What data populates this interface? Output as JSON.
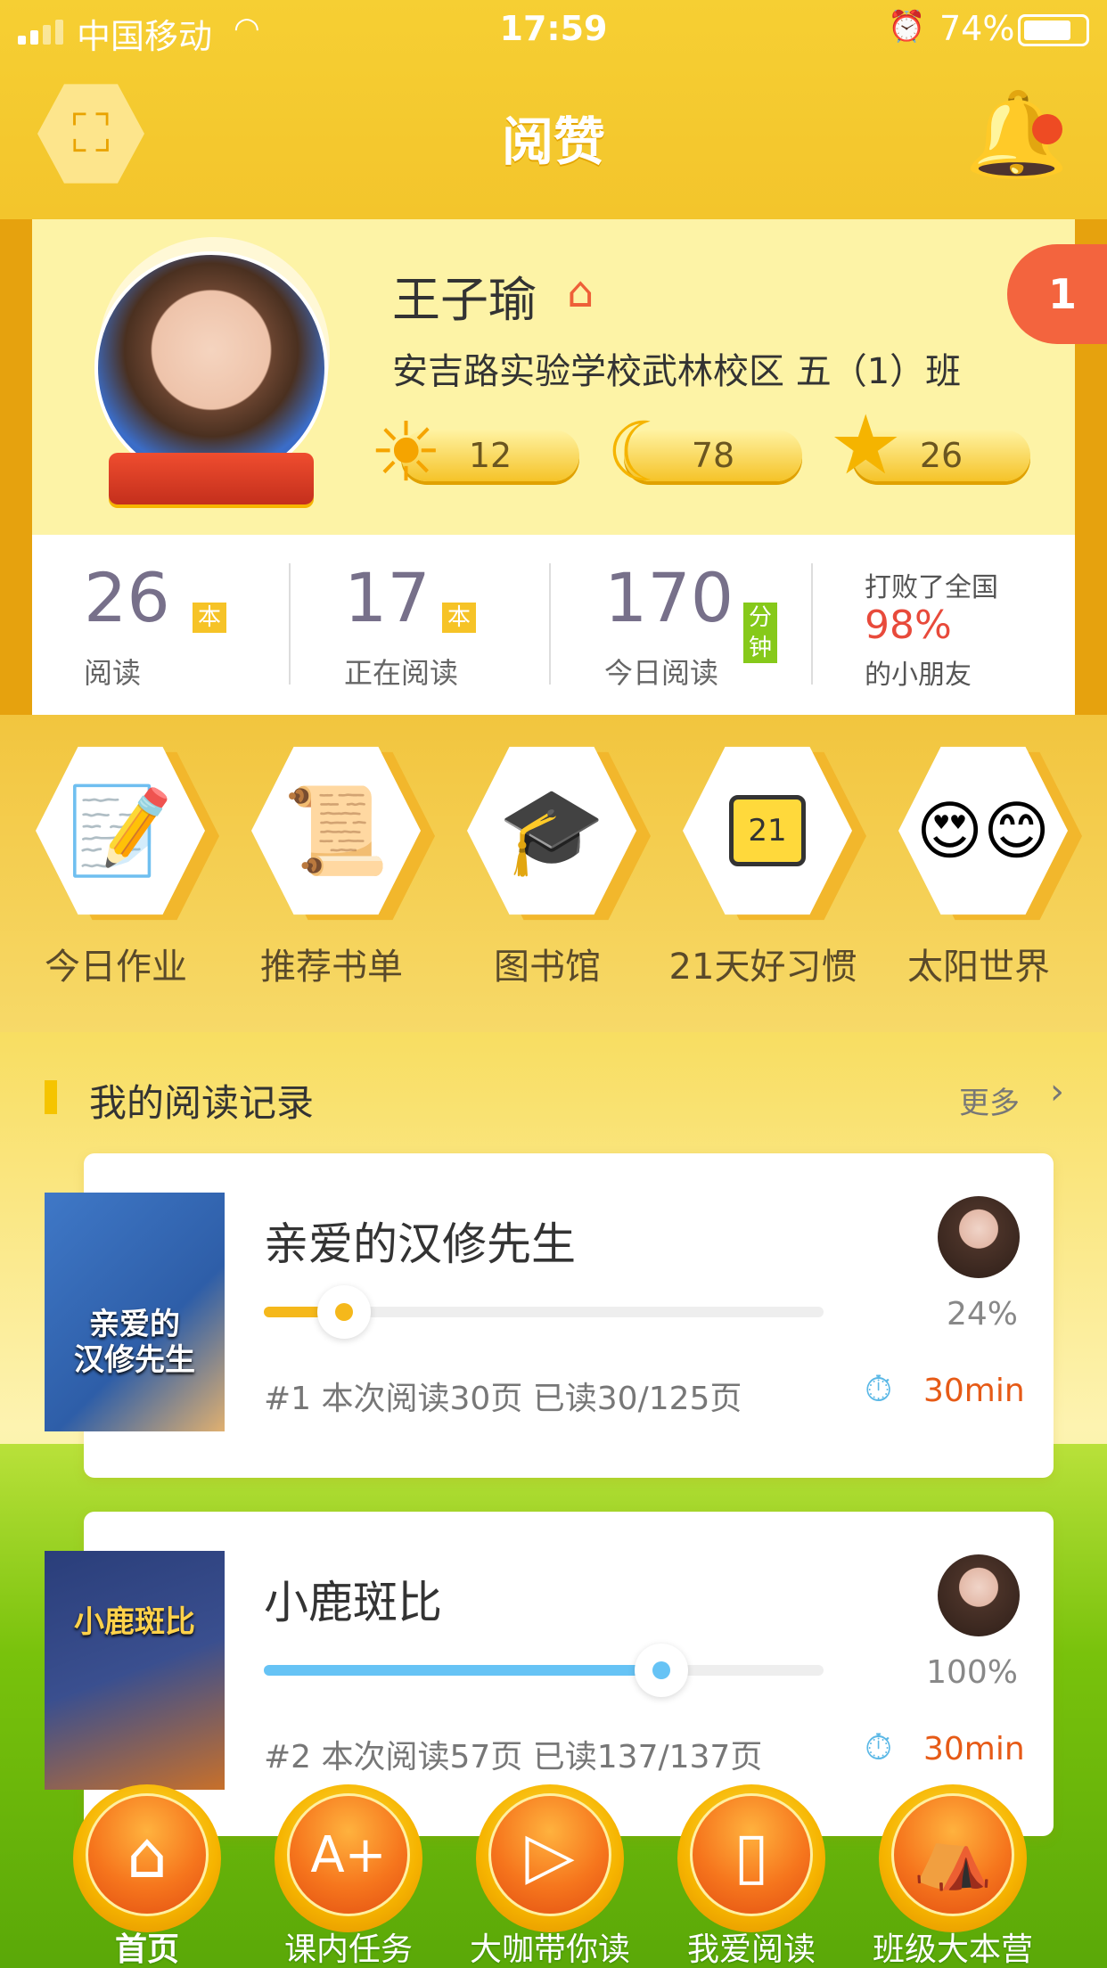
{
  "status_bar": {
    "carrier": "中国移动",
    "time": "17:59",
    "battery": "74%"
  },
  "header": {
    "title": "阅赞"
  },
  "profile": {
    "name": "王子瑜",
    "school": "安吉路实验学校武林校区   五（1）班",
    "notification_badge": "1",
    "sun_count": "12",
    "moon_count": "78",
    "star_count": "26"
  },
  "stats": {
    "read": {
      "value": "26",
      "unit": "本",
      "label": "阅读"
    },
    "reading": {
      "value": "17",
      "unit": "本",
      "label": "正在阅读"
    },
    "today": {
      "value": "170",
      "unit": "分钟",
      "label": "今日阅读"
    },
    "beat_line1": "打败了全国",
    "beat_percent": "98%",
    "beat_line3": "的小朋友"
  },
  "menu": [
    {
      "label": "今日作业",
      "icon": "homework-icon"
    },
    {
      "label": "推荐书单",
      "icon": "scroll-icon"
    },
    {
      "label": "图书馆",
      "icon": "library-icon"
    },
    {
      "label": "21天好习惯",
      "icon": "calendar-icon",
      "calendar_day": "21"
    },
    {
      "label": "太阳世界",
      "icon": "sun-faces-icon"
    }
  ],
  "records": {
    "title": "我的阅读记录",
    "more": "更多",
    "items": [
      {
        "title": "亲爱的汉修先生",
        "progress_percent": 24,
        "progress_label": "24%",
        "meta": "#1 本次阅读30页 已读30/125页",
        "minutes": "30min",
        "cover_text": "亲爱的\n汉修先生",
        "accent": "#f5b81b"
      },
      {
        "title": "小鹿斑比",
        "progress_percent": 100,
        "progress_label": "100%",
        "meta": "#2 本次阅读57页 已读137/137页",
        "minutes": "30min",
        "cover_text": "小鹿斑比",
        "accent": "#66c3f5"
      }
    ]
  },
  "tabbar": [
    {
      "label": "首页",
      "icon": "home-icon",
      "active": true
    },
    {
      "label": "课内任务",
      "icon": "task-icon",
      "active": false
    },
    {
      "label": "大咖带你读",
      "icon": "play-icon",
      "active": false
    },
    {
      "label": "我爱阅读",
      "icon": "book-icon",
      "active": false
    },
    {
      "label": "班级大本营",
      "icon": "tent-icon",
      "active": false
    }
  ]
}
